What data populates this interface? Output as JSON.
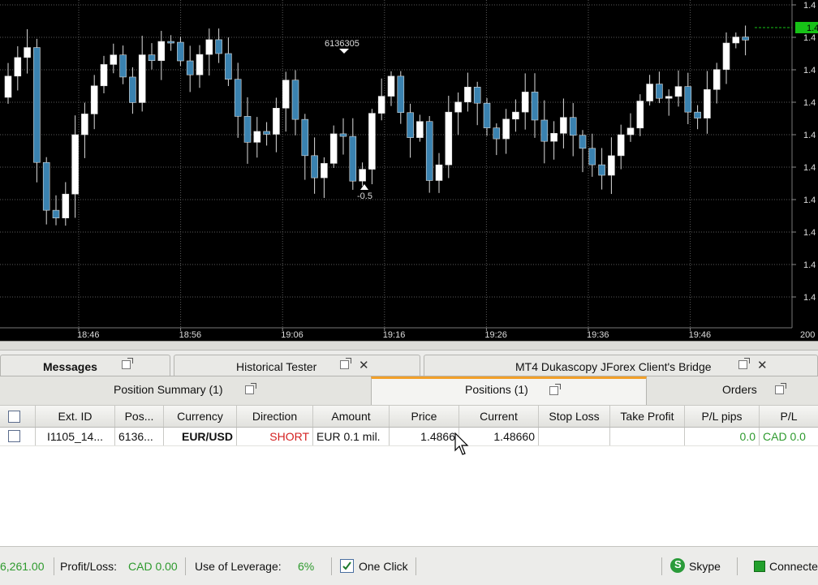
{
  "chart": {
    "annotations": {
      "top_label": "6136305",
      "bottom_label": "-0.5"
    },
    "time_labels": [
      "18:46",
      "18:56",
      "19:06",
      "19:16",
      "19:26",
      "19:36",
      "19:46"
    ],
    "price_labels": [
      "1.4",
      "1.4",
      "1.4",
      "1.4",
      "1.4",
      "1.4",
      "1.4",
      "1.4",
      "1.4",
      "1.4"
    ],
    "corner_label": "200",
    "current_price_tag": "1.4"
  },
  "tabs_top": {
    "messages": "Messages",
    "historical_tester": "Historical Tester",
    "bridge": "MT4 Dukascopy JForex Client's Bridge"
  },
  "tabs_sub": {
    "position_summary": "Position Summary (1)",
    "positions": "Positions (1)",
    "orders": "Orders"
  },
  "table": {
    "headers": [
      "Ext. ID",
      "Pos...",
      "Currency",
      "Direction",
      "Amount",
      "Price",
      "Current",
      "Stop Loss",
      "Take Profit",
      "P/L pips",
      "P/L"
    ],
    "row": {
      "ext_id": "I1105_14...",
      "pos": "6136...",
      "currency": "EUR/USD",
      "direction": "SHORT",
      "amount": "EUR 0.1 mil.",
      "price": "1.4866",
      "current": "1.48660",
      "stop_loss": "",
      "take_profit": "",
      "pl_pips": "0.0",
      "pl": "CAD 0.0"
    }
  },
  "status_bar": {
    "equity": "6,261.00",
    "profit_loss_label": "Profit/Loss:",
    "profit_loss_value": "CAD 0.00",
    "leverage_label": "Use of Leverage:",
    "leverage_value": "6%",
    "one_click": "One Click",
    "one_click_checked": true,
    "skype": "Skype",
    "connection": "Connecte"
  },
  "colors": {
    "bull": "#ffffff",
    "bear": "#3a82b0",
    "accent": "#f2a02a",
    "positive": "#2e9a2e",
    "short": "#d42020"
  }
}
